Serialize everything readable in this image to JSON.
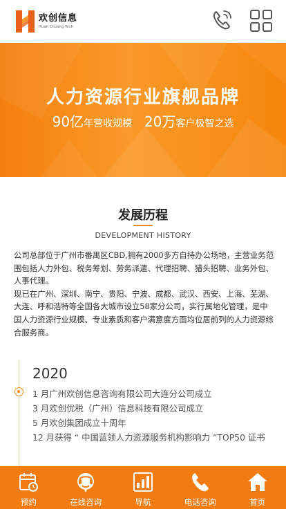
{
  "header": {
    "logo_cn": "欢创信息",
    "logo_en": "Huan Chuang Tech",
    "phone_icon": "phone-icon",
    "menu_icon": "grid-menu-icon"
  },
  "banner": {
    "title": "人力资源行业旗舰品牌",
    "stat1_num": "90亿",
    "stat1_text": "年营收规模",
    "stat2_num": "20万",
    "stat2_text": "客户极智之选"
  },
  "section": {
    "title": "发展历程",
    "subtitle": "DEVELOPMENT HISTORY",
    "intro_p1": "公司总部位于广州市番禺区CBD,拥有2000多方自持办公场地，主营业务范围包括人力外包、税务筹划、劳务派遣、代理招聘、猎头招聘、业务外包、人事代理。",
    "intro_p2": "现已在广州、深圳、南宁、贵阳、宁波、成都、武汉、西安、上海、芜湖、大连、呼和浩特等全国各大城市设立58家分公司，实行属地化管理，是中国人力资源行业规模、专业素质和客户满意度方面均位居前列的人力资源综合服务商。"
  },
  "timeline": {
    "year": "2020",
    "items": [
      "1 月广州欢创信息咨询有限公司大连分公司成立",
      "3 月欢创优税（广州）信息科技有限公司成立",
      "5 月欢创集团成立十周年",
      "12 月获得 “ 中国蓝领人力资源服务机构影响力 ”TOP50 证书"
    ]
  },
  "bottom_nav": [
    {
      "label": "预约",
      "icon": "calendar-icon"
    },
    {
      "label": "在线咨询",
      "icon": "chat-icon"
    },
    {
      "label": "导航",
      "icon": "navigation-icon"
    },
    {
      "label": "电话咨询",
      "icon": "phone-icon"
    },
    {
      "label": "首页",
      "icon": "home-icon"
    }
  ],
  "colors": {
    "accent": "#f27c12",
    "banner_light": "#f99a2a",
    "text": "#333333"
  }
}
